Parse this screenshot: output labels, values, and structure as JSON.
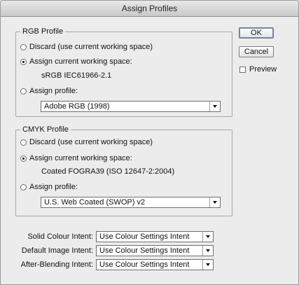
{
  "window": {
    "title": "Assign Profiles"
  },
  "rgb": {
    "legend": "RGB Profile",
    "discard_label": "Discard (use current working space)",
    "assign_current_label": "Assign current working space:",
    "current_space": "sRGB IEC61966-2.1",
    "assign_profile_label": "Assign profile:",
    "profile_value": "Adobe RGB (1998)",
    "selected_option": "assign_current"
  },
  "cmyk": {
    "legend": "CMYK Profile",
    "discard_label": "Discard (use current working space)",
    "assign_current_label": "Assign current working space:",
    "current_space": "Coated FOGRA39 (ISO 12647-2:2004)",
    "assign_profile_label": "Assign profile:",
    "profile_value": "U.S. Web Coated (SWOP) v2",
    "selected_option": "assign_current"
  },
  "buttons": {
    "ok": "OK",
    "cancel": "Cancel"
  },
  "preview": {
    "label": "Preview",
    "checked": false
  },
  "intents": [
    {
      "label": "Solid Colour Intent:",
      "value": "Use Colour Settings Intent"
    },
    {
      "label": "Default Image Intent:",
      "value": "Use Colour Settings Intent"
    },
    {
      "label": "After-Blending Intent:",
      "value": "Use Colour Settings Intent"
    }
  ]
}
